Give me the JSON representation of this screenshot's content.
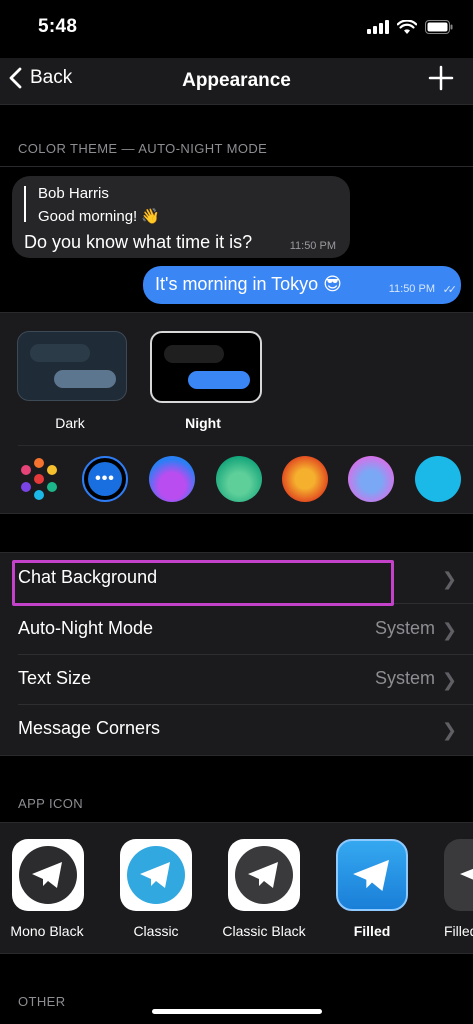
{
  "status": {
    "time": "5:48"
  },
  "nav": {
    "back_label": "Back",
    "title": "Appearance"
  },
  "color_theme": {
    "header": "COLOR THEME — AUTO-NIGHT MODE",
    "preview": {
      "reply_name": "Bob Harris",
      "reply_text": "Good morning! 👋",
      "incoming_text": "Do you know what time it is?",
      "incoming_time": "11:50 PM",
      "outgoing_text": "It's morning in Tokyo 😎",
      "outgoing_time": "11:50 PM"
    },
    "themes": [
      {
        "label": "Dark",
        "selected": false
      },
      {
        "label": "Night",
        "selected": true
      }
    ],
    "accent_colors": [
      "multicolor",
      "#1a6fe0",
      "#7a44e6",
      "#1bb78a",
      "#f5732e",
      "#d86fe8",
      "#1bb9e8"
    ]
  },
  "settings": [
    {
      "label": "Chat Background",
      "value": ""
    },
    {
      "label": "Auto-Night Mode",
      "value": "System"
    },
    {
      "label": "Text Size",
      "value": "System"
    },
    {
      "label": "Message Corners",
      "value": ""
    }
  ],
  "app_icon": {
    "header": "APP ICON",
    "icons": [
      {
        "label": "Mono Black",
        "selected": false
      },
      {
        "label": "Classic",
        "selected": false
      },
      {
        "label": "Classic Black",
        "selected": false
      },
      {
        "label": "Filled",
        "selected": true
      },
      {
        "label": "Filled",
        "selected": false
      }
    ]
  },
  "other": {
    "header": "OTHER"
  }
}
